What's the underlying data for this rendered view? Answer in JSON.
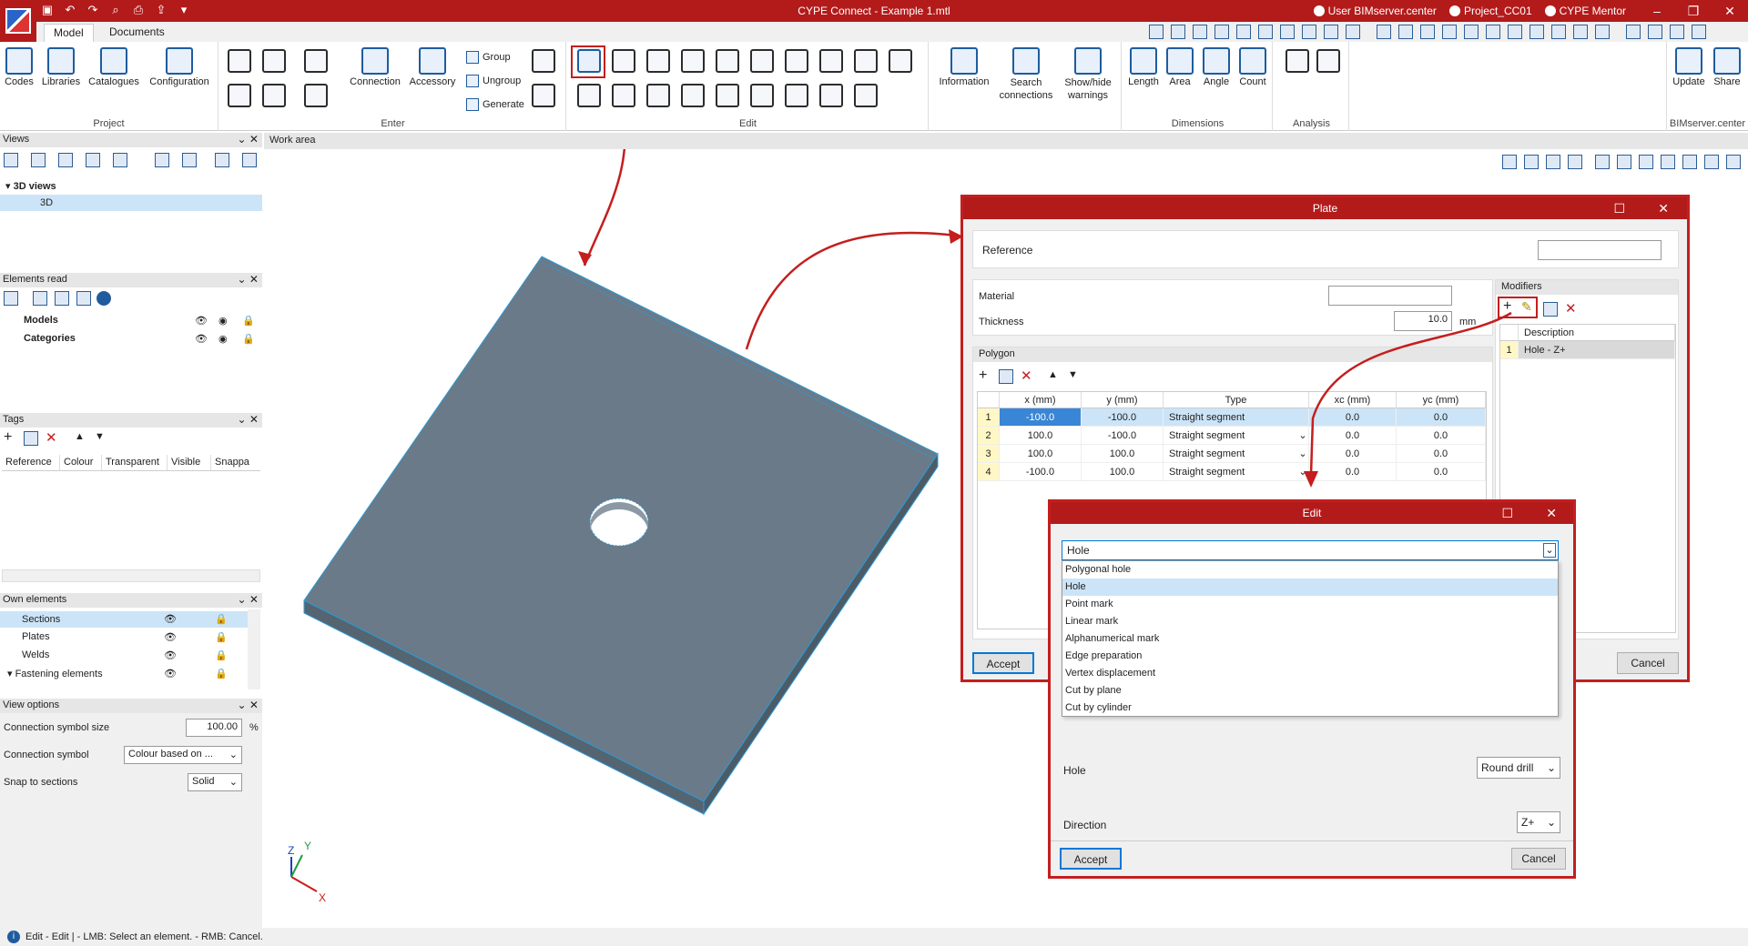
{
  "app": {
    "title": "CYPE Connect - Example 1.mtl",
    "user": "User BIMserver.center",
    "project": "Project_CC01",
    "mentor": "CYPE Mentor"
  },
  "tabs": [
    "Model",
    "Documents"
  ],
  "ribbon": {
    "project": {
      "label": "Project",
      "codes": "Codes",
      "libraries": "Libraries",
      "catalogues": "Catalogues",
      "configuration": "Configuration"
    },
    "enter": {
      "label": "Enter",
      "connection": "Connection",
      "accessory": "Accessory",
      "group": "Group",
      "ungroup": "Ungroup",
      "generate": "Generate"
    },
    "edit": {
      "label": "Edit"
    },
    "info": {
      "information": "Information",
      "search": "Search connections",
      "show_hide": "Show/hide warnings"
    },
    "dimensions": {
      "label": "Dimensions",
      "length": "Length",
      "area": "Area",
      "angle": "Angle",
      "count": "Count"
    },
    "analysis": {
      "label": "Analysis"
    },
    "bim": {
      "label": "BIMserver.center",
      "update": "Update",
      "share": "Share"
    }
  },
  "panels": {
    "views": {
      "title": "Views",
      "group": "3D views",
      "item": "3D"
    },
    "elements_read": {
      "title": "Elements read",
      "models": "Models",
      "categories": "Categories"
    },
    "tags": {
      "title": "Tags",
      "columns": [
        "Reference",
        "Colour",
        "Transparent",
        "Visible",
        "Snappa"
      ]
    },
    "own_elements": {
      "title": "Own elements",
      "items": [
        "Sections",
        "Plates",
        "Welds",
        "Fastening elements"
      ]
    },
    "view_options": {
      "title": "View options",
      "symbol_size_label": "Connection symbol size",
      "symbol_size_value": "100.00",
      "symbol_size_unit": "%",
      "symbol_label": "Connection symbol",
      "symbol_value": "Colour based on ...",
      "snap_label": "Snap to sections",
      "snap_value": "Solid"
    }
  },
  "work_area": {
    "title": "Work area"
  },
  "status": {
    "text": "Edit - Edit  |  - LMB: Select an element. - RMB: Cancel."
  },
  "plate_dialog": {
    "title": "Plate",
    "reference_label": "Reference",
    "reference_value": "",
    "material_label": "Material",
    "material_value": "",
    "thickness_label": "Thickness",
    "thickness_value": "10.0",
    "thickness_unit": "mm",
    "polygon_label": "Polygon",
    "columns": [
      "x (mm)",
      "y (mm)",
      "Type",
      "xc (mm)",
      "yc (mm)"
    ],
    "rows": [
      {
        "n": "1",
        "x": "-100.0",
        "y": "-100.0",
        "type": "Straight segment",
        "xc": "0.0",
        "yc": "0.0"
      },
      {
        "n": "2",
        "x": "100.0",
        "y": "-100.0",
        "type": "Straight segment",
        "xc": "0.0",
        "yc": "0.0"
      },
      {
        "n": "3",
        "x": "100.0",
        "y": "100.0",
        "type": "Straight segment",
        "xc": "0.0",
        "yc": "0.0"
      },
      {
        "n": "4",
        "x": "-100.0",
        "y": "100.0",
        "type": "Straight segment",
        "xc": "0.0",
        "yc": "0.0"
      }
    ],
    "modifiers_label": "Modifiers",
    "modifiers_col": "Description",
    "modifiers": [
      {
        "n": "1",
        "desc": "Hole - Z+"
      }
    ],
    "accept": "Accept",
    "cancel": "Cancel"
  },
  "edit_dialog": {
    "title": "Edit",
    "selected": "Hole",
    "options": [
      "Polygonal hole",
      "Hole",
      "Point mark",
      "Linear mark",
      "Alphanumerical mark",
      "Edge preparation",
      "Vertex displacement",
      "Cut by plane",
      "Cut by cylinder"
    ],
    "hole_label": "Hole",
    "hole_value": "Round drill",
    "direction_label": "Direction",
    "direction_value": "Z+",
    "accept": "Accept",
    "cancel": "Cancel"
  },
  "axes": {
    "x": "X",
    "y": "Y",
    "z": "Z"
  },
  "colors": {
    "brand": "#b31b1b",
    "plate": "#6a7a88",
    "highlight": "#c41e1e",
    "selection": "#cce4f7"
  }
}
